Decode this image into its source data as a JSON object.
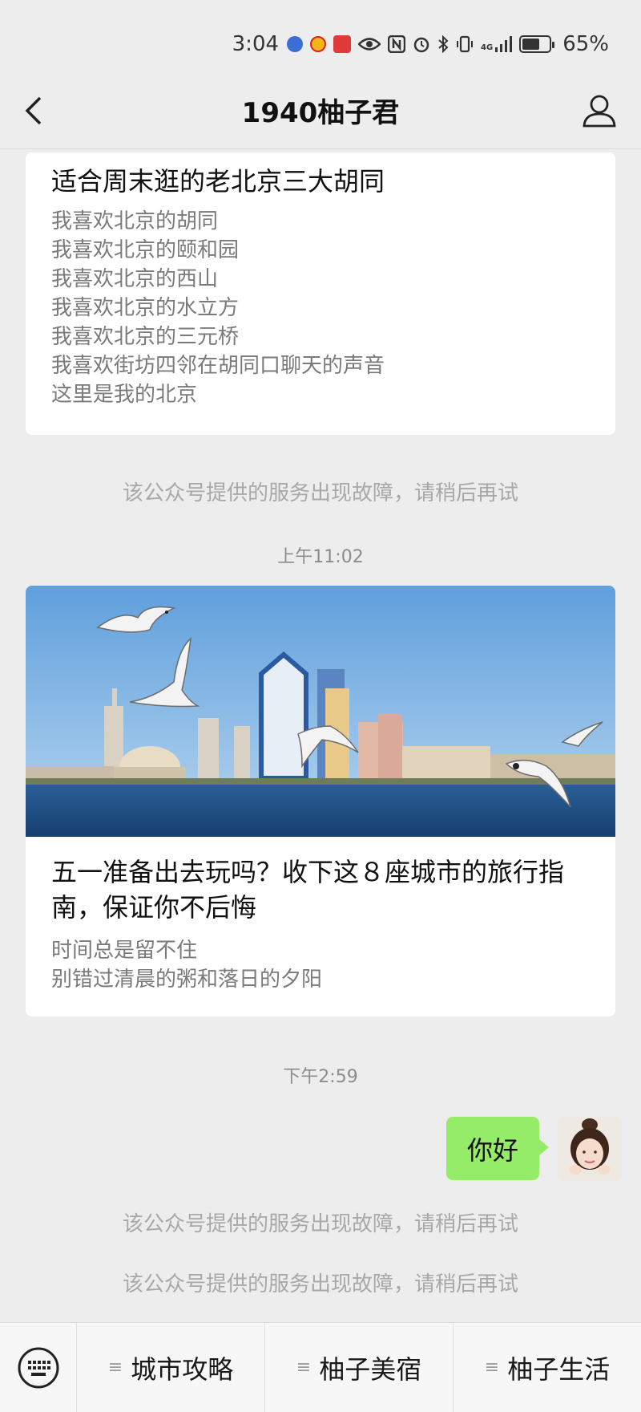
{
  "status_bar": {
    "time": "3:04",
    "battery_percent_text": "65%",
    "battery_level": 0.65,
    "network_label": "4G",
    "icons": [
      "music-app-icon",
      "weibo-app-icon",
      "red-app-icon",
      "eye-icon",
      "nfc-icon",
      "alarm-icon",
      "bluetooth-icon",
      "vibrate-icon",
      "signal-icon",
      "battery-icon"
    ]
  },
  "nav": {
    "title": "1940柚子君"
  },
  "card1": {
    "title": "适合周末逛的老北京三大胡同",
    "lines": [
      "我喜欢北京的胡同",
      "我喜欢北京的颐和园",
      "我喜欢北京的西山",
      "我喜欢北京的水立方",
      "我喜欢北京的三元桥",
      "我喜欢街坊四邻在胡同口聊天的声音",
      "这里是我的北京"
    ]
  },
  "system_messages": [
    "该公众号提供的服务出现故障，请稍后再试",
    "该公众号提供的服务出现故障，请稍后再试",
    "该公众号提供的服务出现故障，请稍后再试"
  ],
  "timestamps": [
    "上午11:02",
    "下午2:59"
  ],
  "card2": {
    "title": "五一准备出去玩吗？收下这８座城市的旅行指南，保证你不后悔",
    "lines": [
      "时间总是留不住",
      "别错过清晨的粥和落日的夕阳"
    ]
  },
  "my_message": {
    "text": "你好"
  },
  "bottom_menu": {
    "items": [
      "城市攻略",
      "柚子美宿",
      "柚子生活"
    ]
  },
  "colors": {
    "background": "#ededed",
    "bubble": "#95ec69",
    "sky": "#7fb3e6",
    "sea": "#1f4f85"
  }
}
